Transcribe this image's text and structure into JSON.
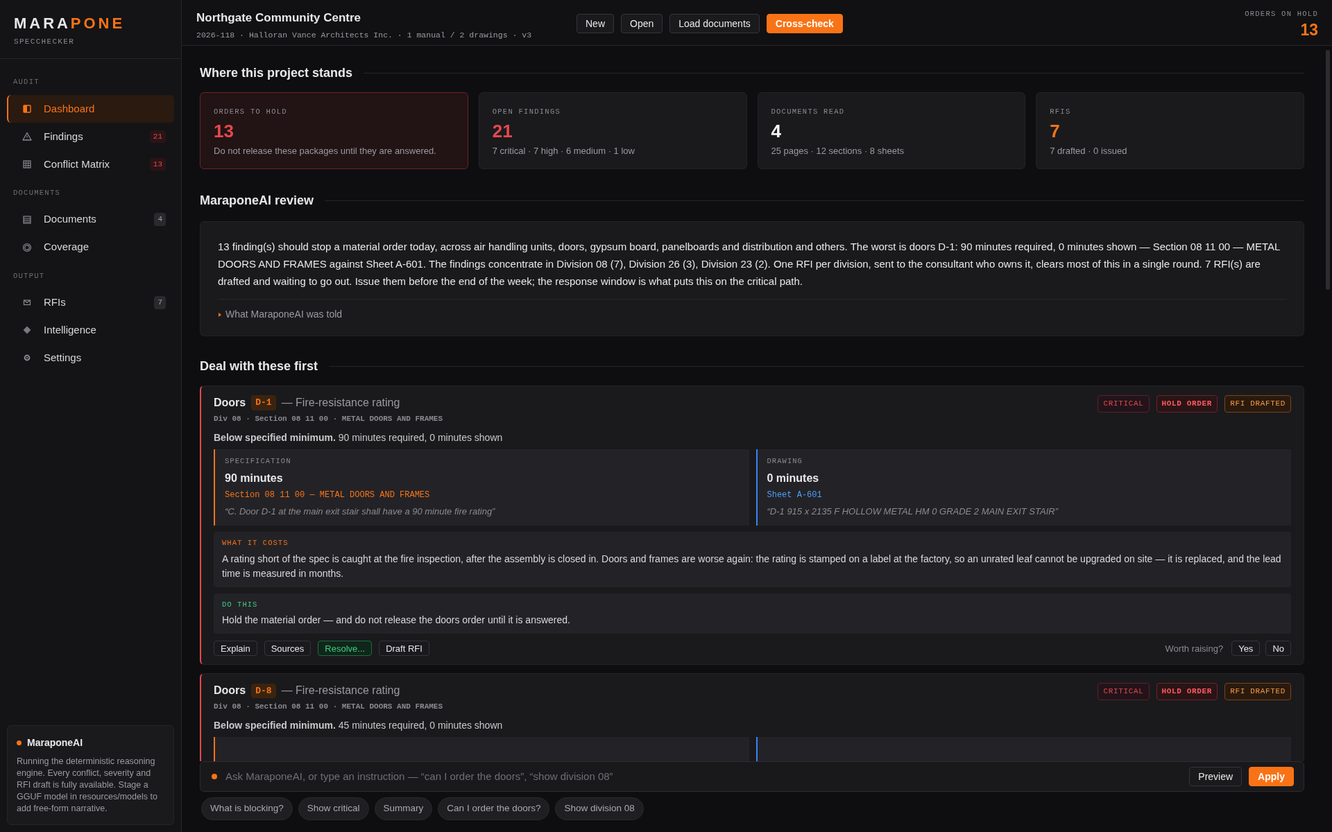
{
  "sidebar": {
    "logo": {
      "first": "MARA",
      "second": "PONE"
    },
    "subtitle": "SPECCHECKER",
    "sections": [
      {
        "title": "AUDIT",
        "items": [
          {
            "label": "Dashboard",
            "selected": true
          },
          {
            "label": "Findings",
            "selected": false,
            "badge": "21",
            "kind": "alert"
          },
          {
            "label": "Conflict Matrix",
            "selected": false,
            "badge": "13",
            "kind": "alert"
          }
        ]
      },
      {
        "title": "DOCUMENTS",
        "items": [
          {
            "label": "Documents",
            "selected": false,
            "badge": "4",
            "kind": "count"
          },
          {
            "label": "Coverage",
            "selected": false
          }
        ]
      },
      {
        "title": "OUTPUT",
        "items": [
          {
            "label": "RFIs",
            "selected": false,
            "badge": "7",
            "kind": "count"
          },
          {
            "label": "Intelligence",
            "selected": false
          },
          {
            "label": "Settings",
            "selected": false
          }
        ]
      }
    ],
    "assistant": {
      "title": "MaraponeAI",
      "text": "Running the deterministic reasoning engine. Every conflict, severity and RFI draft is fully available. Stage a GGUF model in resources/models to add free-form narrative."
    }
  },
  "header": {
    "title": "Northgate Community Centre",
    "meta": "2026-118 · Halloran Vance Architects Inc. · 1 manual / 2 drawings · v3",
    "buttons": [
      {
        "label": "New",
        "kind": "plain"
      },
      {
        "label": "Open",
        "kind": "plain"
      },
      {
        "label": "Load documents",
        "kind": "plain"
      },
      {
        "label": "Cross-check",
        "kind": "primary"
      }
    ],
    "orders_on_hold": {
      "label": "ORDERS ON HOLD",
      "value": "13"
    }
  },
  "standing": {
    "title": "Where this project stands",
    "cards": [
      {
        "label": "ORDERS TO HOLD",
        "value": "13",
        "detail": "Do not release these packages until they are answered.",
        "color": "#e5484d",
        "highlighted": true
      },
      {
        "label": "OPEN FINDINGS",
        "value": "21",
        "detail": "7 critical · 7 high · 6 medium · 1 low",
        "color": "#e5484d",
        "highlighted": false
      },
      {
        "label": "DOCUMENTS READ",
        "value": "4",
        "detail": "25 pages · 12 sections · 8 sheets",
        "color": "#f5f5f5",
        "highlighted": false
      },
      {
        "label": "RFIS",
        "value": "7",
        "detail": "7 drafted · 0 issued",
        "color": "#f97316",
        "highlighted": false
      }
    ]
  },
  "review": {
    "title": "MaraponeAI review",
    "text": "13 finding(s) should stop a material order today, across air handling units, doors, gypsum board, panelboards and distribution and others. The worst is doors D-1: 90 minutes required, 0 minutes shown — Section 08 11 00 — METAL DOORS AND FRAMES against Sheet A-601. The findings concentrate in Division 08 (7), Division 26 (3), Division 23 (2). One RFI per division, sent to the consultant who owns it, clears most of this in a single round. 7 RFI(s) are drafted and waiting to go out. Issue them before the end of the week; the response window is what puts this on the critical path.",
    "disclosure": {
      "label": "What MaraponeAI was told",
      "expanded": false
    }
  },
  "findings": {
    "title": "Deal with these first",
    "items": [
      {
        "category": "Doors",
        "tag": "D-1",
        "title": "— Fire-resistance rating",
        "meta": "Div 08 · Section 08 11 00 · METAL DOORS AND FRAMES",
        "summary": "**Below specified minimum.** 90 minutes required, 0 minutes shown",
        "badges": [
          {
            "label": "CRITICAL",
            "kind": "critical"
          },
          {
            "label": "HOLD ORDER",
            "kind": "hold"
          },
          {
            "label": "RFI DRAFTED",
            "kind": "rfi"
          }
        ],
        "spec": {
          "label": "SPECIFICATION",
          "value": "90 minutes",
          "source": "Section 08 11 00 — METAL DOORS AND FRAMES",
          "quote": "“C. Door D-1 at the main exit stair shall have a 90 minute fire rating”"
        },
        "drawing": {
          "label": "DRAWING",
          "value": "0 minutes",
          "source": "Sheet A-601",
          "quote": "“D-1 915 x 2135 F HOLLOW METAL HM 0 GRADE 2 MAIN EXIT STAIR”"
        },
        "cost": {
          "label": "WHAT IT COSTS",
          "text": "A rating short of the spec is caught at the fire inspection, after the assembly is closed in. Doors and frames are worse again: the rating is stamped on a label at the factory, so an unrated leaf cannot be upgraded on site — it is replaced, and the lead time is measured in months."
        },
        "action": {
          "label": "DO THIS",
          "text": "Hold the material order — and do not release the doors order until it is answered."
        },
        "buttons": [
          {
            "label": "Explain",
            "kind": "plain"
          },
          {
            "label": "Sources",
            "kind": "plain"
          },
          {
            "label": "Resolve...",
            "kind": "resolve"
          },
          {
            "label": "Draft RFI",
            "kind": "plain"
          }
        ],
        "feedback": {
          "prompt": "Worth raising?",
          "options": [
            "Yes",
            "No"
          ]
        }
      },
      {
        "category": "Doors",
        "tag": "D-8",
        "title": "— Fire-resistance rating",
        "meta": "Div 08 · Section 08 11 00 · METAL DOORS AND FRAMES",
        "summary": "**Below specified minimum.** 45 minutes required, 0 minutes shown",
        "badges": [
          {
            "label": "CRITICAL",
            "kind": "critical"
          },
          {
            "label": "HOLD ORDER",
            "kind": "hold"
          },
          {
            "label": "RFI DRAFTED",
            "kind": "rfi"
          }
        ]
      }
    ]
  },
  "command": {
    "placeholder": "Ask MaraponeAI, or type an instruction — “can I order the doors”, “show division 08”",
    "buttons": [
      {
        "label": "Preview",
        "kind": "plain"
      },
      {
        "label": "Apply",
        "kind": "primary"
      }
    ],
    "chips": [
      "What is blocking?",
      "Show critical",
      "Summary",
      "Can I order the doors?",
      "Show division 08"
    ]
  }
}
